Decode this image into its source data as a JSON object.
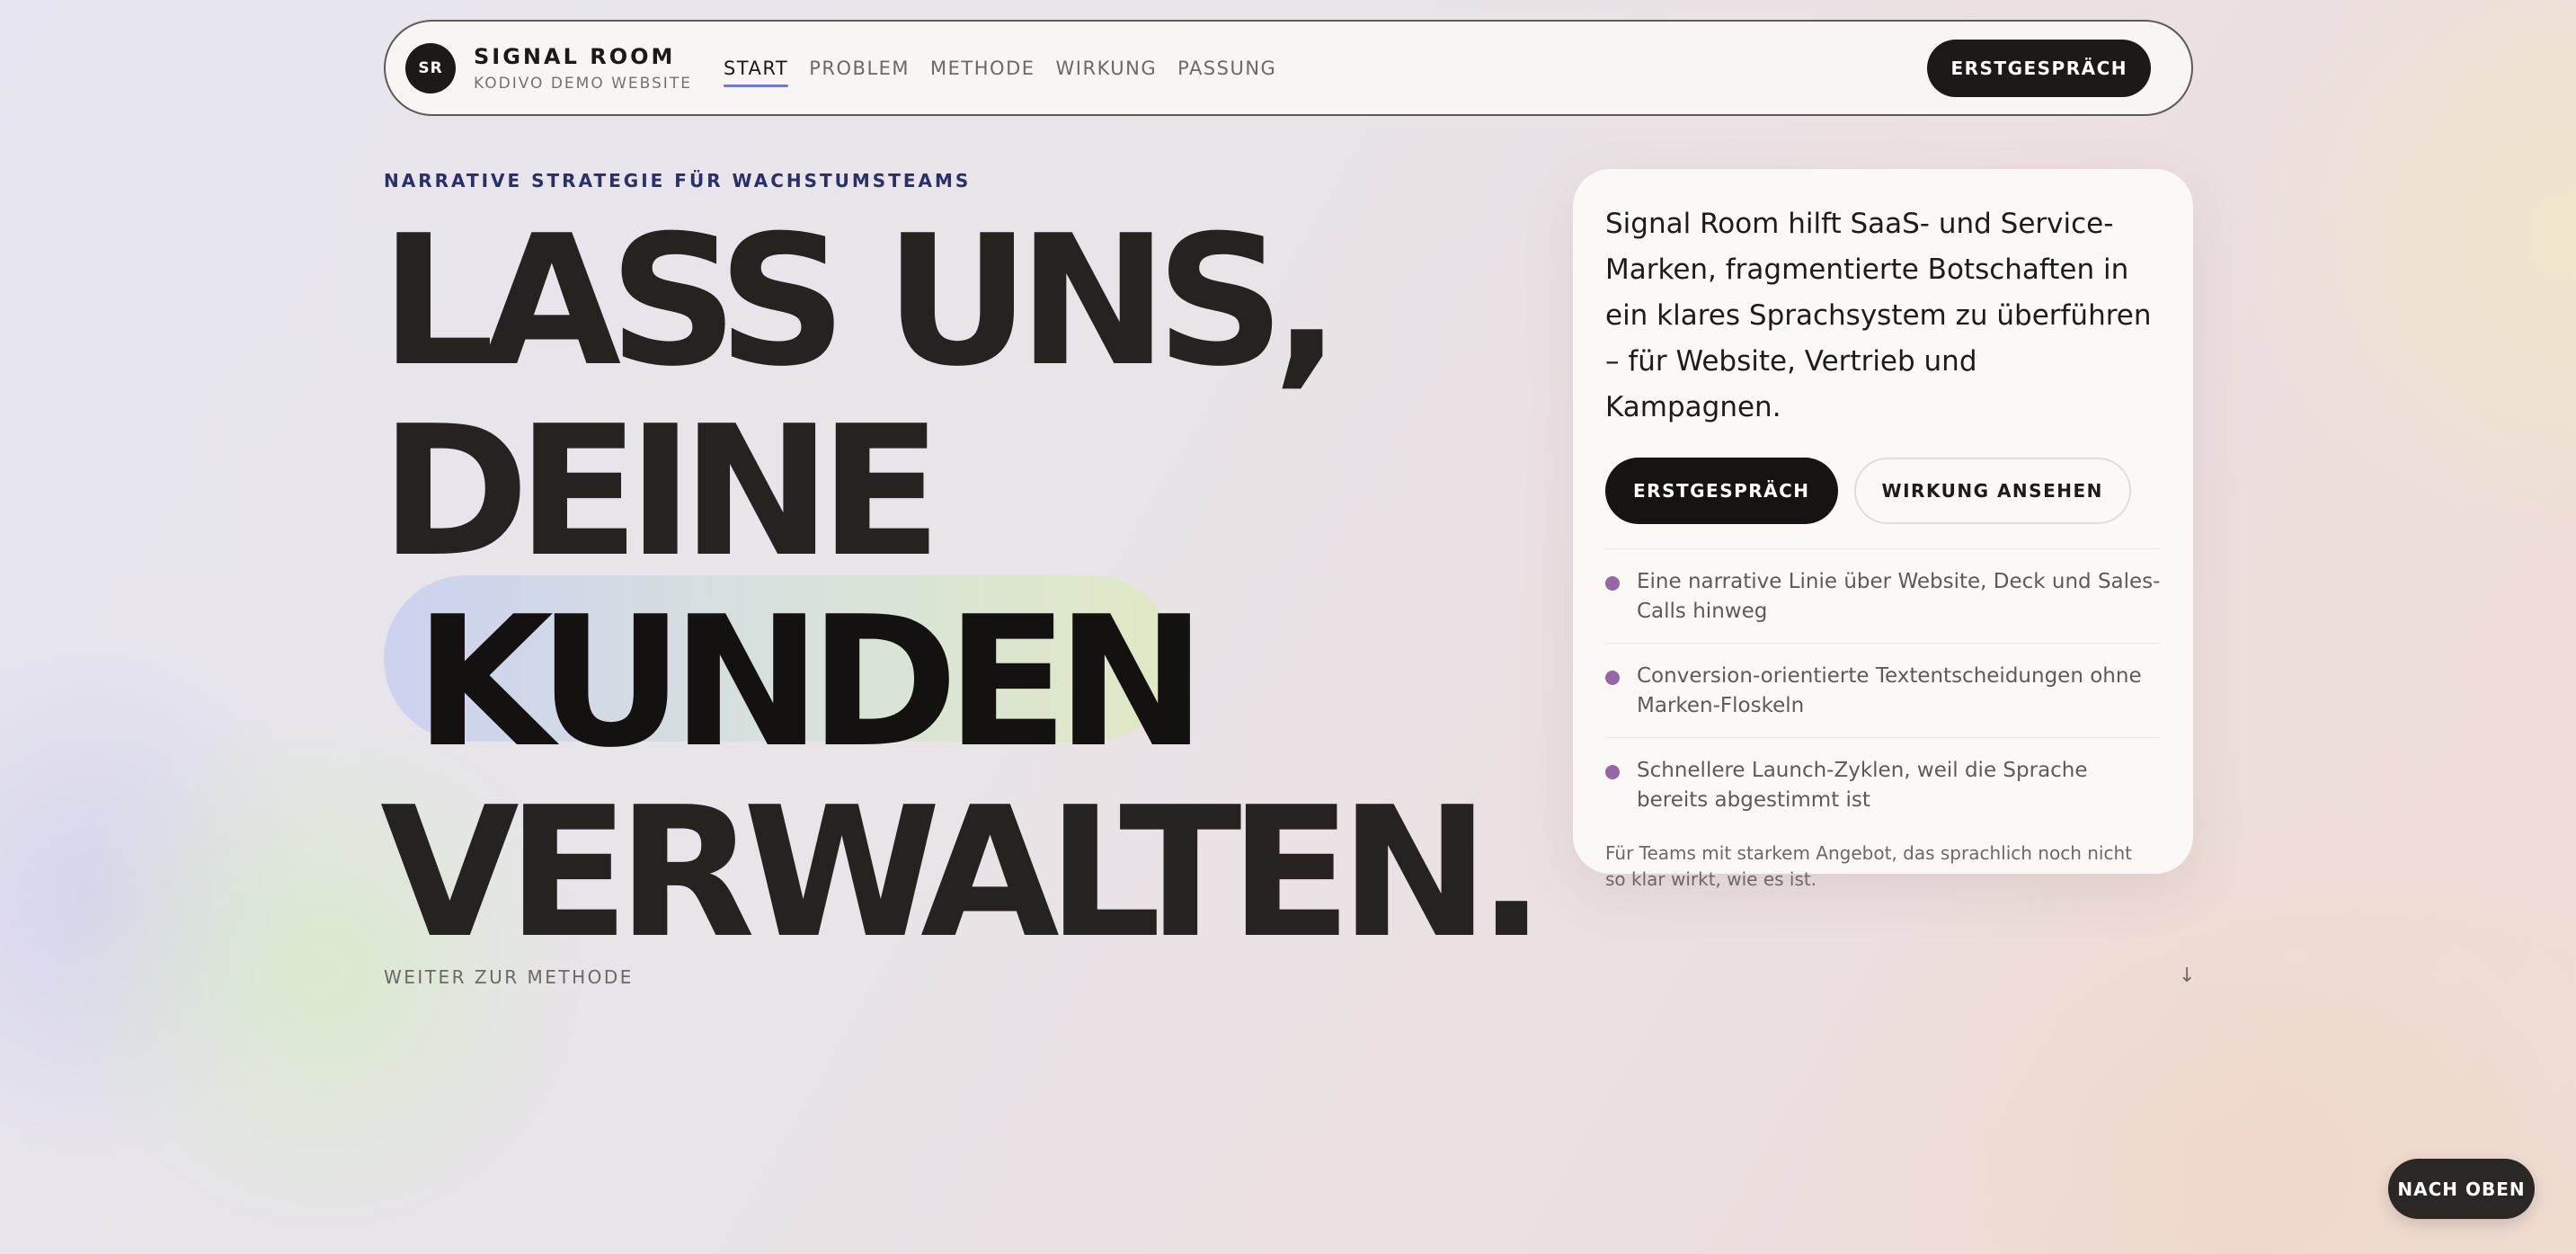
{
  "brand": {
    "logo_text": "SR",
    "name": "SIGNAL ROOM",
    "subtitle": "KODIVO DEMO WEBSITE"
  },
  "nav": {
    "items": [
      {
        "label": "START",
        "active": true
      },
      {
        "label": "PROBLEM",
        "active": false
      },
      {
        "label": "METHODE",
        "active": false
      },
      {
        "label": "WIRKUNG",
        "active": false
      },
      {
        "label": "PASSUNG",
        "active": false
      }
    ],
    "cta_label": "ERSTGESPRÄCH"
  },
  "hero": {
    "eyebrow": "NARRATIVE STRATEGIE FÜR WACHSTUMSTEAMS",
    "lines": [
      "LASS UNS,",
      "DEINE",
      "KUNDEN",
      "VERWALTEN."
    ],
    "scroll_label": "WEITER ZUR METHODE",
    "scroll_arrow": "↓"
  },
  "card": {
    "lead": "Signal Room hilft SaaS- und Service-Marken, fragmentierte Botschaften in ein klares Sprachsystem zu überführen – für Website, Vertrieb und Kampagnen.",
    "primary_label": "ERSTGESPRÄCH",
    "secondary_label": "WIRKUNG ANSEHEN",
    "points": [
      "Eine narrative Linie über Website, Deck und Sales-Calls hinweg",
      "Conversion-orientierte Textentscheidungen ohne Marken-Floskeln",
      "Schnellere Launch-Zyklen, weil die Sprache bereits abgestimmt ist"
    ],
    "note": "Für Teams mit starkem Angebot, das sprachlich noch nicht so klar wirkt, wie es ist."
  },
  "back_to_top": {
    "label": "NACH OBEN"
  },
  "colors": {
    "ink": "#1c1917",
    "accent_underline": "#6e7ad6",
    "bullet": "#9667a6",
    "eyebrow": "#2a2f6a"
  }
}
